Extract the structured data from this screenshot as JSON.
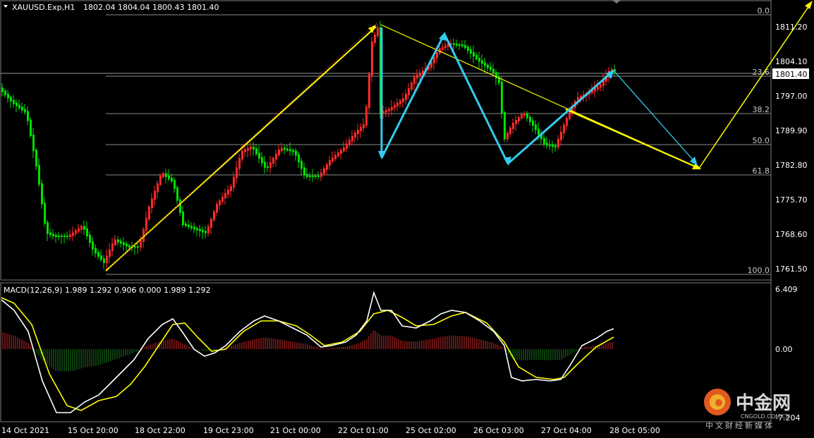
{
  "header": {
    "symbol": "XAUUSD.Exp,H1",
    "ohlc": "1802.04 1804.04 1800.43 1801.40",
    "current_price": "1801.40"
  },
  "price_axis": [
    "1811.20",
    "1804.10",
    "1797.00",
    "1789.90",
    "1782.80",
    "1775.70",
    "1768.60",
    "1761.50"
  ],
  "fib_levels": [
    "0.0",
    "23.6",
    "38.2",
    "50.0",
    "61.8",
    "100.0"
  ],
  "macd": {
    "label": "MACD(12,26,9) 1.989 1.292 0.906 0.000 1.989 1.292",
    "axis_top": "6.409",
    "axis_zero": "0.00",
    "axis_bottom": "-7.204"
  },
  "time_axis": [
    "14 Oct 2021",
    "15 Oct 20:00",
    "18 Oct 22:00",
    "19 Oct 23:00",
    "21 Oct 00:00",
    "22 Oct 01:00",
    "25 Oct 02:00",
    "26 Oct 03:00",
    "27 Oct 04:00",
    "28 Oct 05:00"
  ],
  "watermark": {
    "name": "中金网",
    "domain": "CNGOLD.COM.CN",
    "sub": "中文财经新媒体"
  },
  "colors": {
    "background": "#000000",
    "bull_candle": "#ff2a2a",
    "bear_candle": "#00e000",
    "fib_line": "#8a8a8a",
    "projection_yellow": "#ffff00",
    "projection_cyan": "#33ccee",
    "macd_line": "#ffffff",
    "signal_line": "#ffff00",
    "hist_positive": "#cc2a2a",
    "hist_negative": "#1a7a1a"
  }
}
